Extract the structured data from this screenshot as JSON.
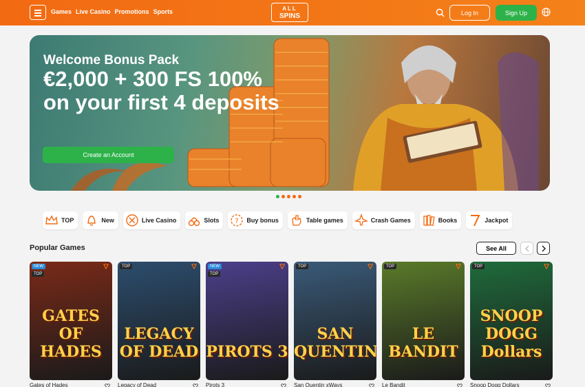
{
  "header": {
    "logo_top": "ALL",
    "logo_bottom": "SPINS",
    "nav": [
      "Games",
      "Live Casino",
      "Promotions",
      "Sports"
    ],
    "login_label": "Log In",
    "signup_label": "Sign Up"
  },
  "banner": {
    "kicker": "Welcome Bonus Pack",
    "headline": "€2,000 + 300 FS 100% on your first 4 deposits",
    "cta_label": "Create an Account",
    "slides": 5,
    "active_slide": 0
  },
  "categories": [
    {
      "label": "TOP",
      "icon": "crown-icon"
    },
    {
      "label": "New",
      "icon": "bell-icon"
    },
    {
      "label": "Live Casino",
      "icon": "chip-icon"
    },
    {
      "label": "Slots",
      "icon": "cherries-icon"
    },
    {
      "label": "Buy bonus",
      "icon": "bonus-icon"
    },
    {
      "label": "Table games",
      "icon": "hand-icon"
    },
    {
      "label": "Crash Games",
      "icon": "plane-icon"
    },
    {
      "label": "Books",
      "icon": "books-icon"
    },
    {
      "label": "Jackpot",
      "icon": "seven-icon"
    }
  ],
  "popular": {
    "title": "Popular Games",
    "see_all": "See All",
    "games": [
      {
        "name": "Gates of Hades",
        "art": "GATES OF HADES",
        "badges": [
          "NEW",
          "TOP"
        ],
        "bg": "#7a2a18"
      },
      {
        "name": "Legacy of Dead",
        "art": "LEGACY OF DEAD",
        "badges": [
          "TOP"
        ],
        "bg": "#2c4d6e"
      },
      {
        "name": "Pirots 3",
        "art": "PIROTS 3",
        "badges": [
          "NEW",
          "TOP"
        ],
        "bg": "#4c3f8a"
      },
      {
        "name": "San Quentin xWays",
        "art": "SAN QUENTIN",
        "badges": [
          "TOP"
        ],
        "bg": "#3a5a78"
      },
      {
        "name": "Le Bandit",
        "art": "LE BANDIT",
        "badges": [
          "TOP"
        ],
        "bg": "#5a7a2a"
      },
      {
        "name": "Snoop Dogg Dollars",
        "art": "SNOOP DOGG Dollars",
        "badges": [
          "TOP"
        ],
        "bg": "#1f6b3c"
      }
    ]
  }
}
